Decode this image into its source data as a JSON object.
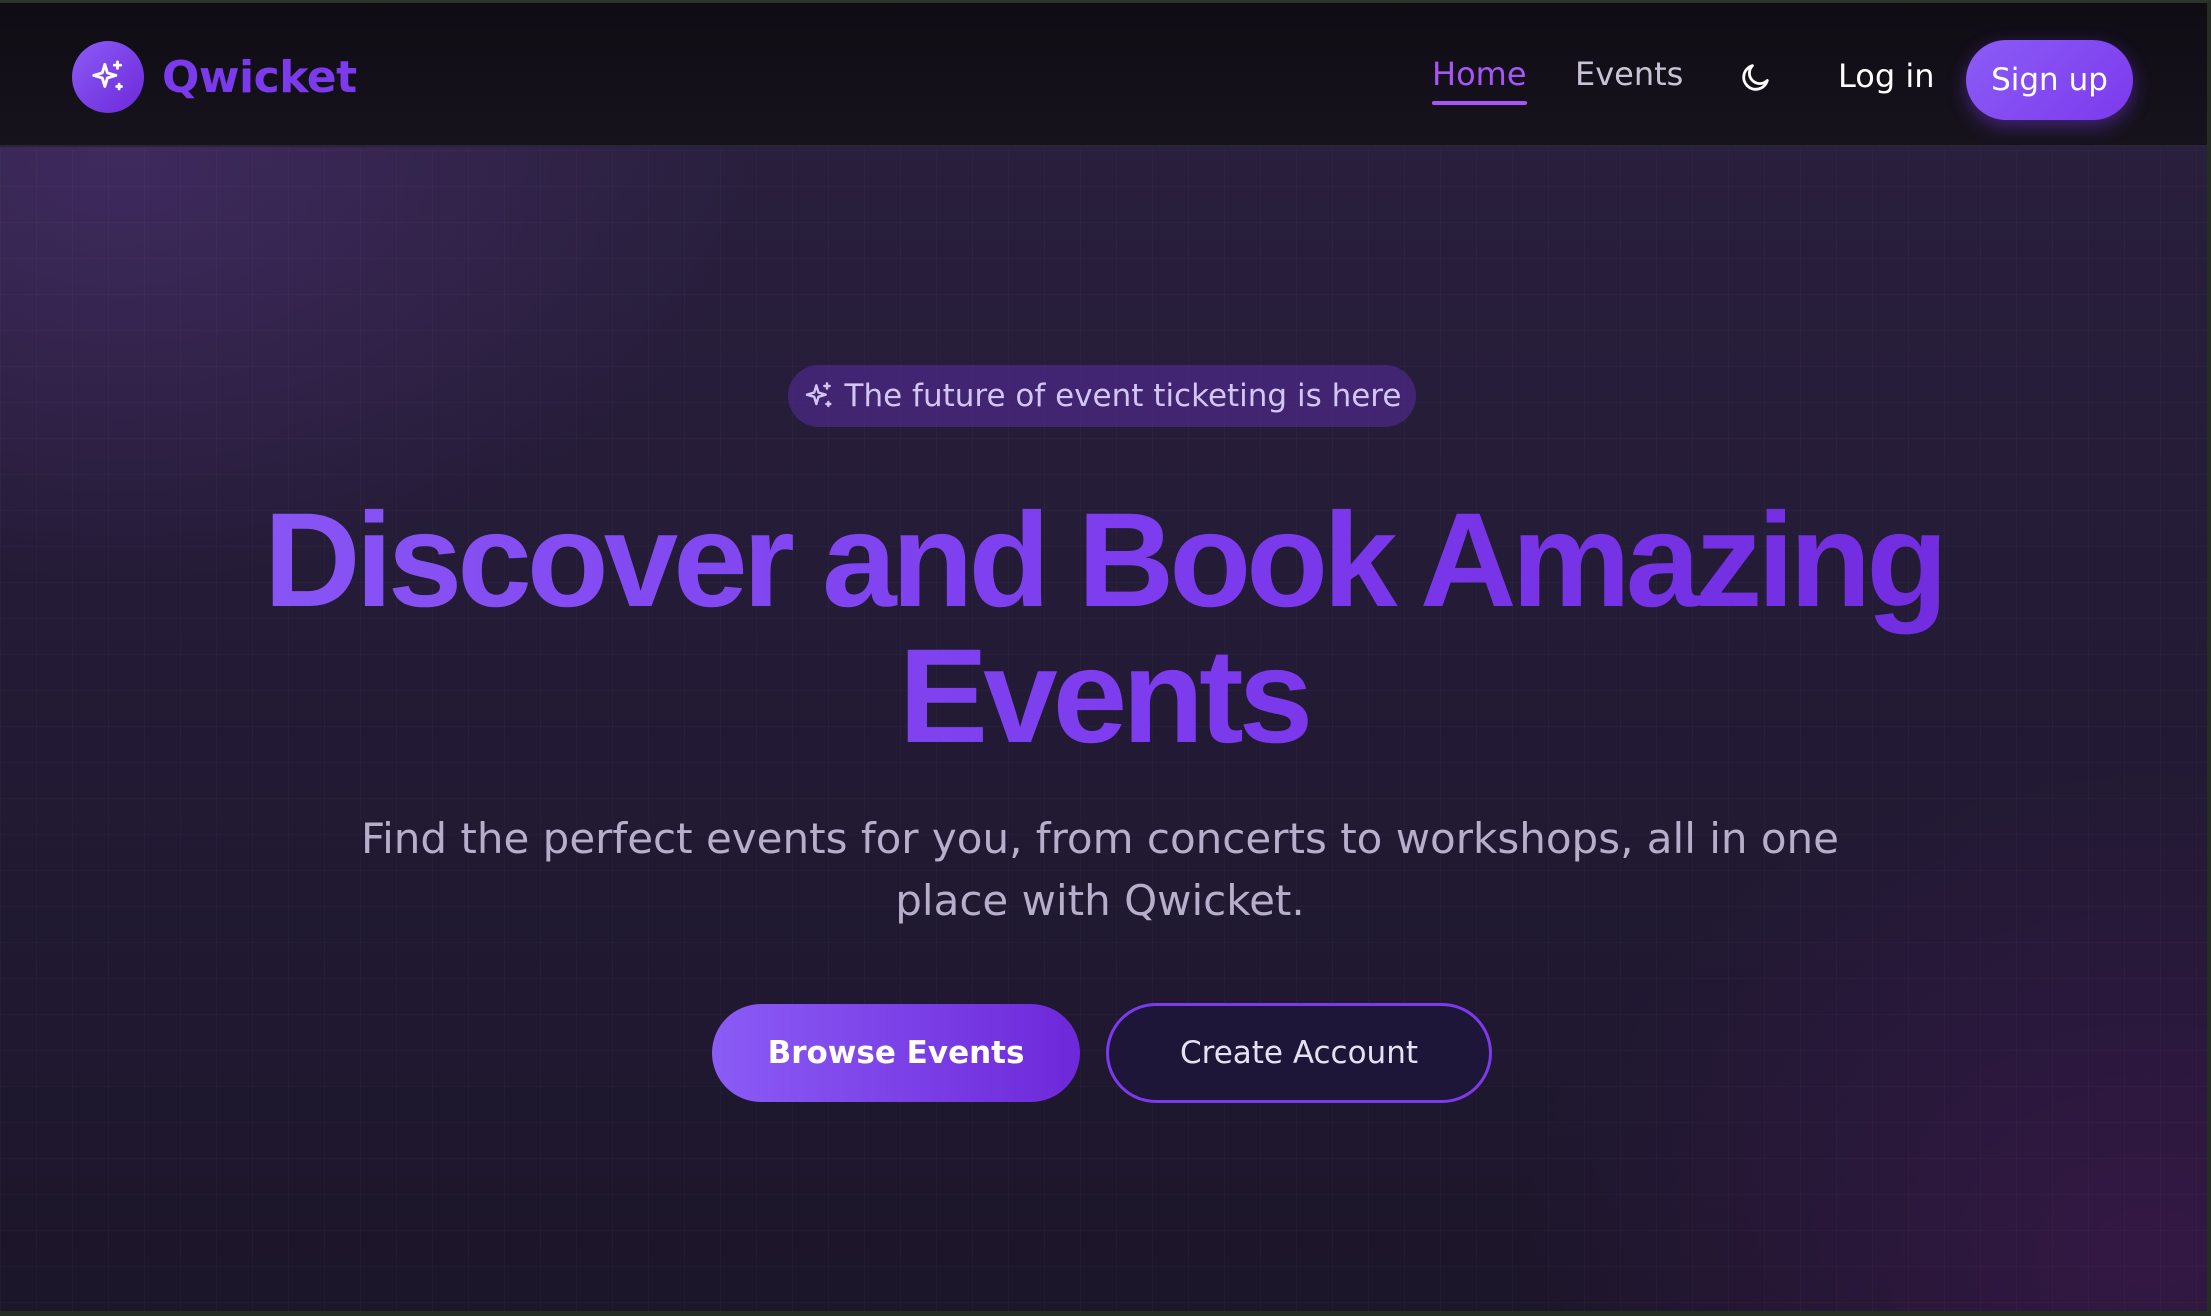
{
  "navbar": {
    "brand": {
      "name": "Qwicket",
      "logo_icon": "sparkles-icon",
      "color": "#7c3aed"
    },
    "links": [
      {
        "label": "Home",
        "active": true
      },
      {
        "label": "Events",
        "active": false
      }
    ],
    "theme_toggle_icon": "moon-icon",
    "login_label": "Log in",
    "signup_label": "Sign up"
  },
  "hero": {
    "badge": {
      "icon": "sparkles-icon",
      "text": "The future of event ticketing is here"
    },
    "headline_line1": "Discover and Book Amazing",
    "headline_line2": "Events",
    "subtitle": "Find the perfect events for you, from concerts to workshops, all in one place with Qwicket.",
    "primary_cta": "Browse Events",
    "secondary_cta": "Create Account"
  },
  "colors": {
    "accent": "#7c3aed",
    "accent_light": "#8b5cf6",
    "nav_active": "#a855f7",
    "background": "#241b36"
  }
}
